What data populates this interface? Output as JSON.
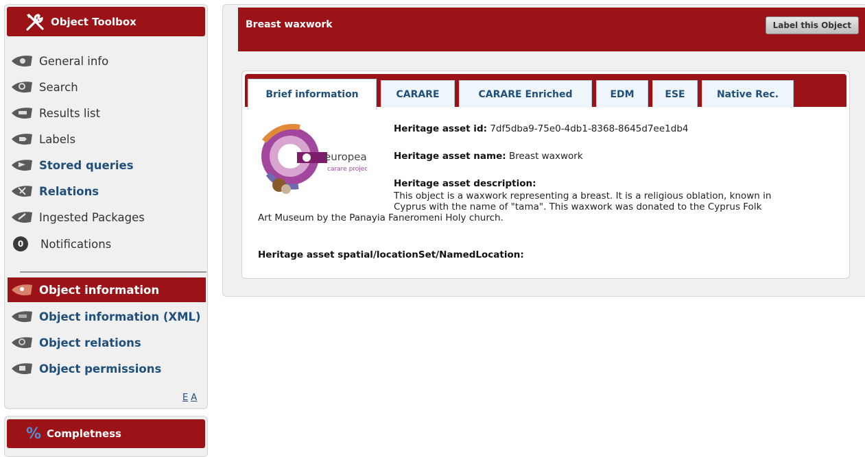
{
  "sidebar": {
    "title": "Object Toolbox",
    "items": [
      {
        "label": "General info",
        "icon": "eye-icon"
      },
      {
        "label": "Search",
        "icon": "search-icon"
      },
      {
        "label": "Results list",
        "icon": "list-icon"
      },
      {
        "label": "Labels",
        "icon": "tag-icon"
      },
      {
        "label": "Stored queries",
        "icon": "stored-query-icon"
      },
      {
        "label": "Relations",
        "icon": "relations-icon"
      },
      {
        "label": "Ingested Packages",
        "icon": "package-icon"
      }
    ],
    "notifications": {
      "label": "Notifications",
      "count": "0"
    },
    "object_items": [
      {
        "label": "Object information",
        "icon": "info-icon"
      },
      {
        "label": "Object information (XML)",
        "icon": "xml-icon"
      },
      {
        "label": "Object relations",
        "icon": "object-relations-icon"
      },
      {
        "label": "Object permissions",
        "icon": "permissions-icon"
      }
    ],
    "lang_e": "E",
    "lang_a": "A",
    "completeness_title": "Completness",
    "completeness_icon": "%"
  },
  "object": {
    "title": "Breast waxwork",
    "label_button": "Label this Object"
  },
  "tabs": [
    {
      "label": "Brief information"
    },
    {
      "label": "CARARE"
    },
    {
      "label": "CARARE Enriched"
    },
    {
      "label": "EDM"
    },
    {
      "label": "ESE"
    },
    {
      "label": "Native Rec."
    }
  ],
  "logo": {
    "name": "europeana",
    "sub": "carare project"
  },
  "fields": {
    "id_label": "Heritage asset id:",
    "id_value": "7df5dba9-75e0-4db1-8368-8645d7ee1db4",
    "name_label": "Heritage asset name:",
    "name_value": "Breast waxwork",
    "desc_label": "Heritage asset description:",
    "desc_line1": "This object is a waxwork representing a breast. It is a religious oblation, known in",
    "desc_line2": "Cyprus with the name of \"tama\". This waxwork was donated to the Cyprus Folk",
    "desc_line3": "Art Museum by the Panayia Faneromeni Holy church.",
    "location_label": "Heritage asset spatial/locationSet/NamedLocation:"
  },
  "colors": {
    "brand_red": "#9b1217",
    "link_blue": "#1f4f7a",
    "tab_bg": "#eef5fb"
  }
}
